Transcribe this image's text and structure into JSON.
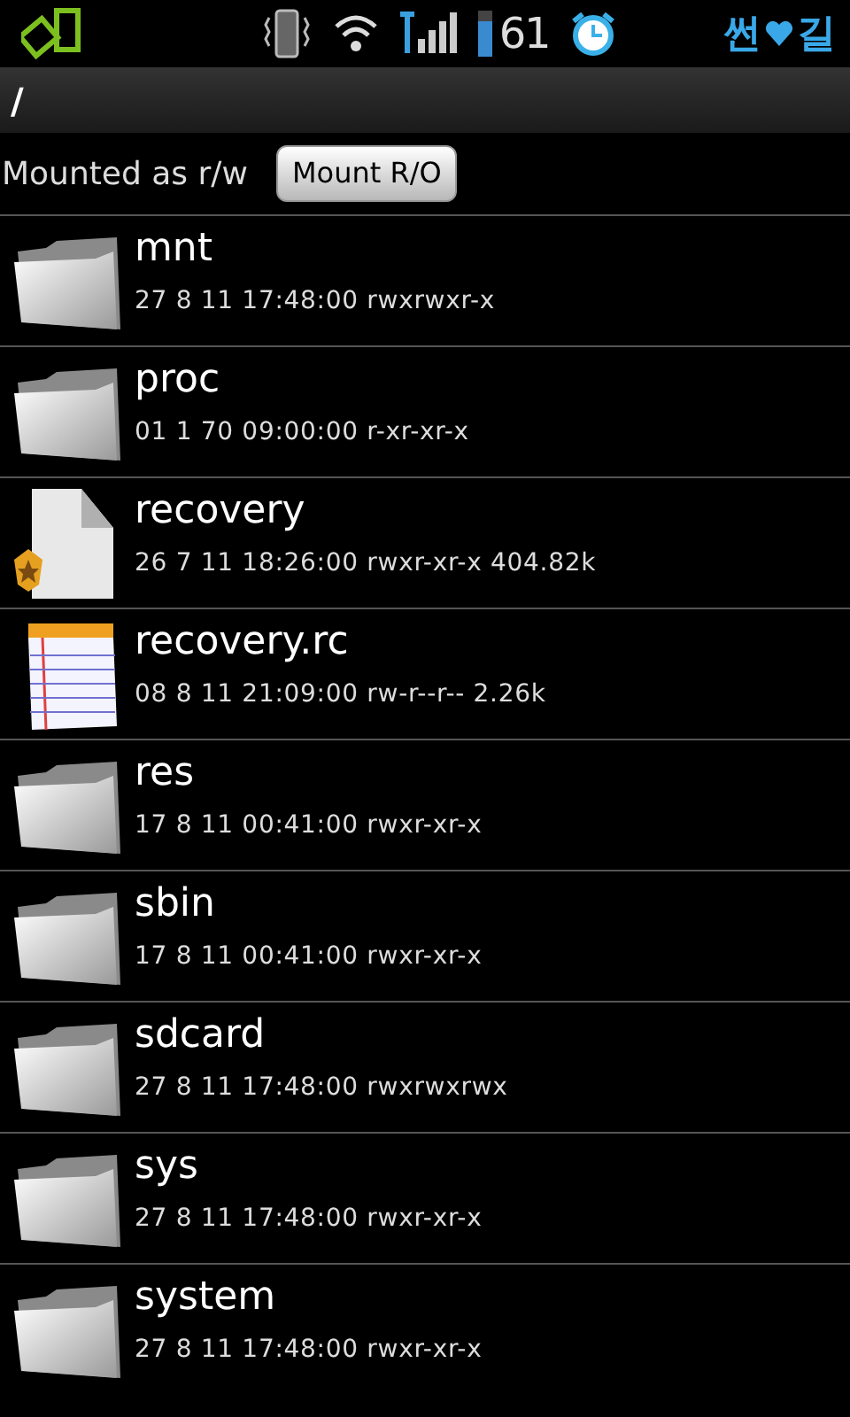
{
  "status_bar": {
    "battery": "61",
    "carrier_left": "썬",
    "carrier_right": "길"
  },
  "path": "/",
  "mount": {
    "status": "Mounted as r/w",
    "button": "Mount R/O"
  },
  "entries": [
    {
      "kind": "folder",
      "name": "mnt",
      "details": "27 8 11 17:48:00 rwxrwxr-x"
    },
    {
      "kind": "folder",
      "name": "proc",
      "details": "01 1 70 09:00:00 r-xr-xr-x"
    },
    {
      "kind": "binary",
      "name": "recovery",
      "details": "26 7 11 18:26:00 rwxr-xr-x 404.82k"
    },
    {
      "kind": "text",
      "name": "recovery.rc",
      "details": "08 8 11 21:09:00 rw-r--r-- 2.26k"
    },
    {
      "kind": "folder",
      "name": "res",
      "details": "17 8 11 00:41:00 rwxr-xr-x"
    },
    {
      "kind": "folder",
      "name": "sbin",
      "details": "17 8 11 00:41:00 rwxr-xr-x"
    },
    {
      "kind": "folder",
      "name": "sdcard",
      "details": "27 8 11 17:48:00 rwxrwxrwx"
    },
    {
      "kind": "folder",
      "name": "sys",
      "details": "27 8 11 17:48:00 rwxr-xr-x"
    },
    {
      "kind": "folder",
      "name": "system",
      "details": "27 8 11 17:48:00 rwxr-xr-x"
    }
  ]
}
